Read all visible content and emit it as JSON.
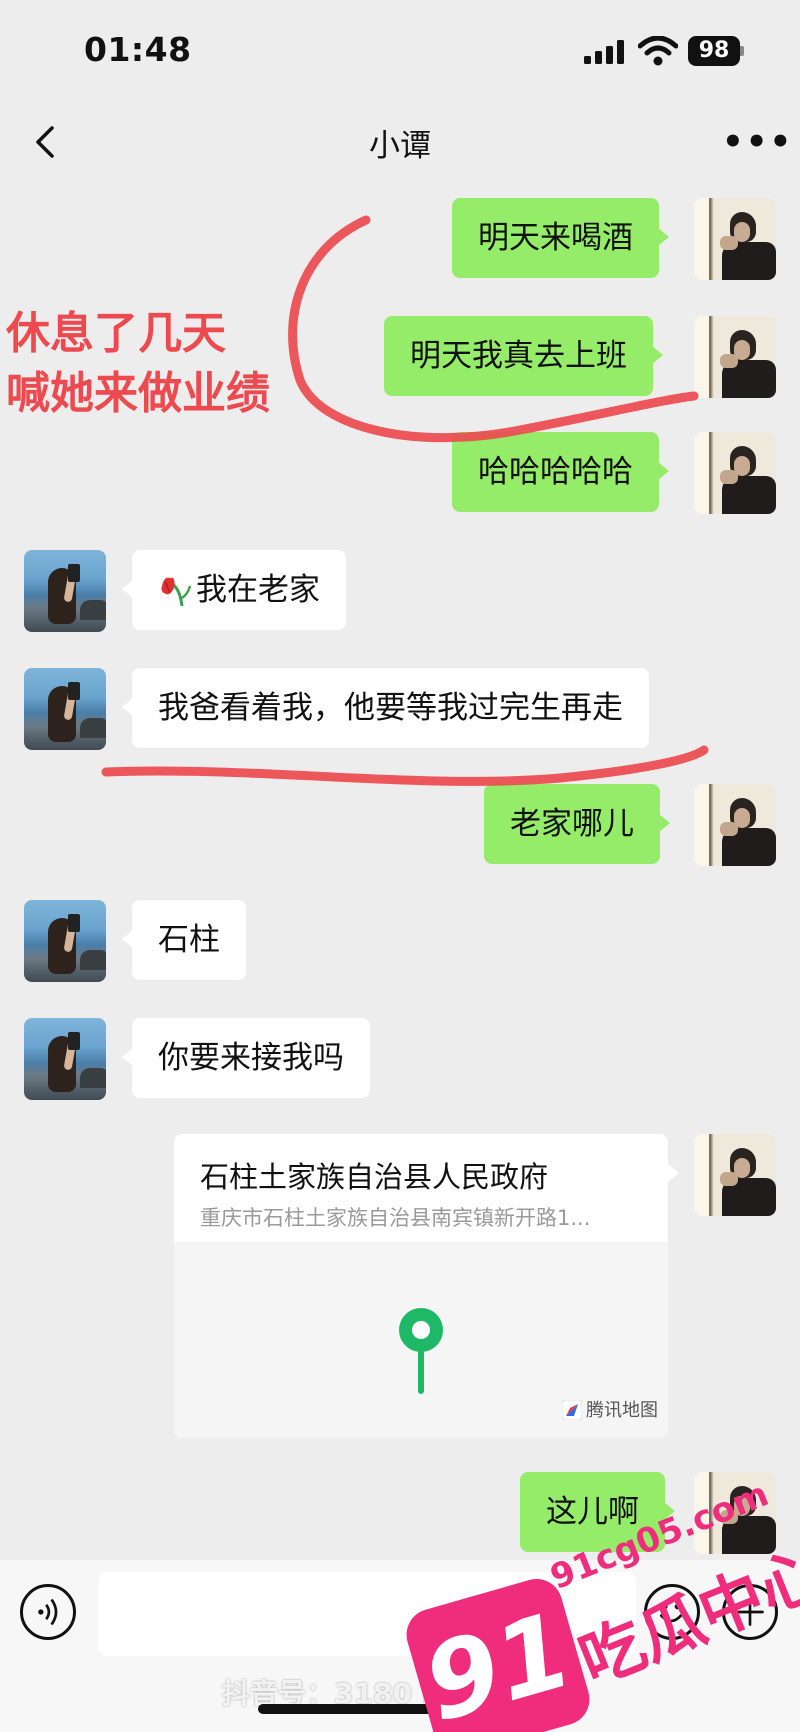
{
  "status_bar": {
    "time": "01:48",
    "battery": "98"
  },
  "header": {
    "title": "小谭"
  },
  "messages": [
    {
      "side": "out",
      "text": "明天来喝酒"
    },
    {
      "side": "out",
      "text": "明天我真去上班"
    },
    {
      "side": "out",
      "text": "哈哈哈哈哈"
    },
    {
      "side": "in",
      "text": "我在老家",
      "emoji": "wilted-flower"
    },
    {
      "side": "in",
      "text": "我爸看着我，他要等我过完生再走"
    },
    {
      "side": "out",
      "text": "老家哪儿"
    },
    {
      "side": "in",
      "text": "石柱"
    },
    {
      "side": "in",
      "text": "你要来接我吗"
    },
    {
      "side": "out",
      "type": "location",
      "name": "石柱土家族自治县人民政府",
      "address": "重庆市石柱土家族自治县南宾镇新开路1...",
      "map_brand": "腾讯地图"
    },
    {
      "side": "out",
      "text": "这儿啊"
    }
  ],
  "annotation": {
    "line1": "休息了几天",
    "line2": "喊她来做业绩",
    "color": "#ec4a4f"
  },
  "input_bar": {
    "value": ""
  },
  "footer": {
    "tiktok_id": "抖音号：3180 28 787"
  },
  "watermark": {
    "badge": "91",
    "site": "91cg05.com",
    "text": "吃瓜中心",
    "color": "#f02d7d"
  },
  "colors": {
    "outgoing_bubble": "#95ec69",
    "incoming_bubble": "#ffffff",
    "background": "#ededed",
    "map_pin": "#1fb866"
  }
}
